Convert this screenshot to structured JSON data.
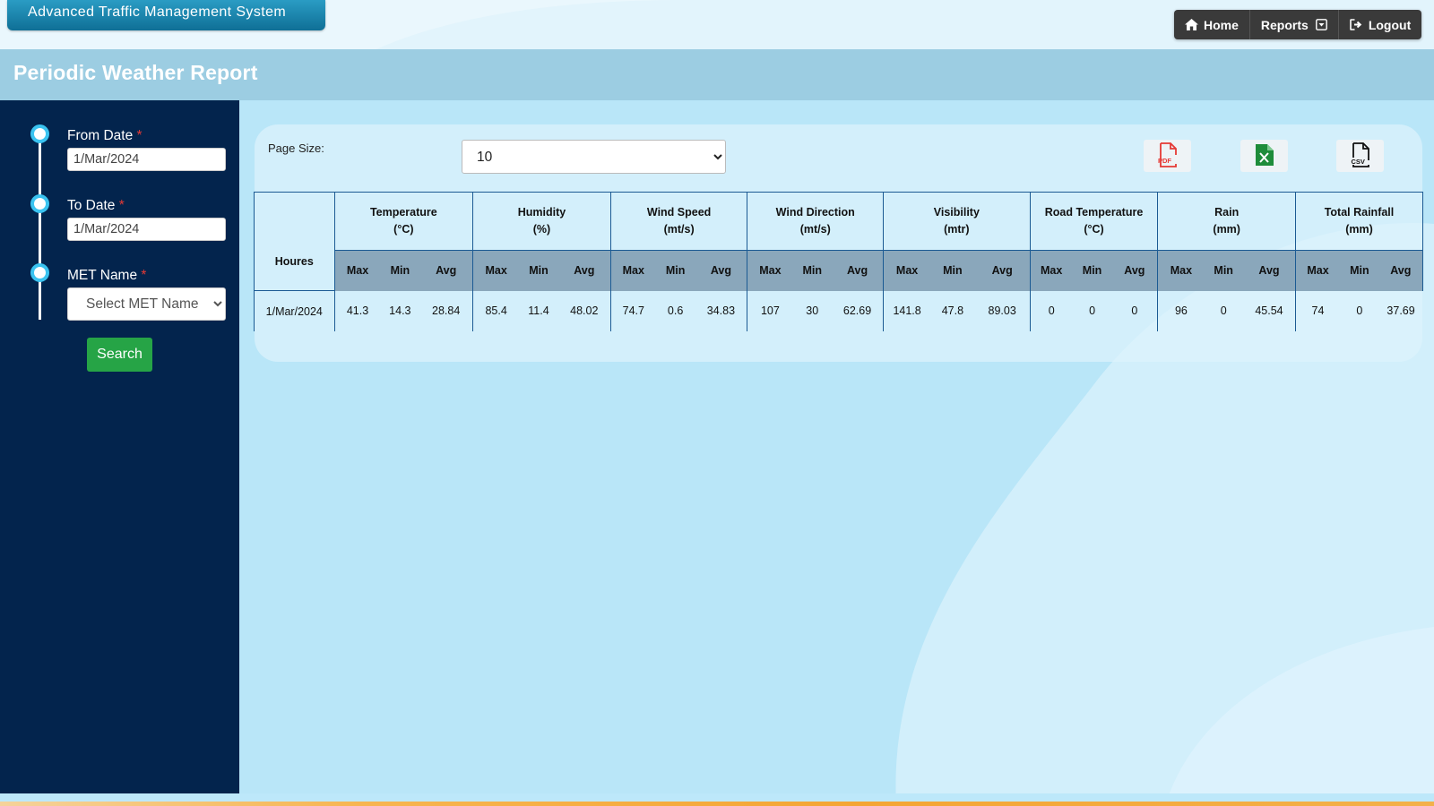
{
  "app": {
    "title": "Advanced Traffic Management System"
  },
  "nav": {
    "home": "Home",
    "reports": "Reports",
    "logout": "Logout"
  },
  "page": {
    "title": "Periodic Weather Report"
  },
  "filters": {
    "from_date": {
      "label": "From Date",
      "required_mark": "*",
      "value": "1/Mar/2024"
    },
    "to_date": {
      "label": "To Date",
      "required_mark": "*",
      "value": "1/Mar/2024"
    },
    "met_name": {
      "label": "MET Name",
      "required_mark": "*",
      "placeholder": "Select MET Name"
    },
    "search_label": "Search"
  },
  "controls": {
    "page_size_label": "Page Size:",
    "page_size_value": "10",
    "export": {
      "pdf_icon": "pdf-file-icon",
      "excel_icon": "excel-file-icon",
      "csv_icon": "csv-file-icon"
    }
  },
  "table": {
    "row_header": "Houres",
    "groups": [
      {
        "name": "Temperature",
        "unit": "(°C)"
      },
      {
        "name": "Humidity",
        "unit": "(%)"
      },
      {
        "name": "Wind Speed",
        "unit": "(mt/s)"
      },
      {
        "name": "Wind Direction",
        "unit": "(mt/s)"
      },
      {
        "name": "Visibility",
        "unit": "(mtr)"
      },
      {
        "name": "Road Temperature",
        "unit": "(°C)"
      },
      {
        "name": "Rain",
        "unit": "(mm)"
      },
      {
        "name": "Total Rainfall",
        "unit": "(mm)"
      }
    ],
    "sub_headers": [
      "Max",
      "Min",
      "Avg"
    ],
    "rows": [
      {
        "hour": "1/Mar/2024",
        "values": [
          [
            "41.3",
            "14.3",
            "28.84"
          ],
          [
            "85.4",
            "11.4",
            "48.02"
          ],
          [
            "74.7",
            "0.6",
            "34.83"
          ],
          [
            "107",
            "30",
            "62.69"
          ],
          [
            "141.8",
            "47.8",
            "89.03"
          ],
          [
            "0",
            "0",
            "0"
          ],
          [
            "96",
            "0",
            "45.54"
          ],
          [
            "74",
            "0",
            "37.69"
          ]
        ]
      }
    ]
  },
  "colors": {
    "sidebar": "#03244d",
    "title_bar": "#96c8de",
    "search_button": "#26a446",
    "table_border": "#1b5a93",
    "subheader_bg": "#8aa7bb",
    "nav_bg": "#3a3a3a"
  }
}
